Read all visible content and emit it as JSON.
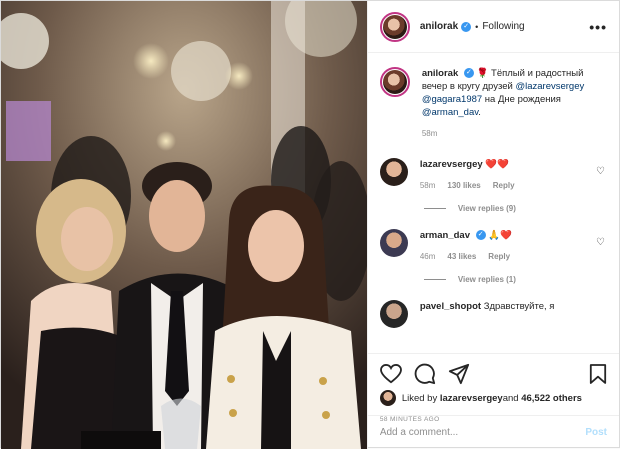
{
  "header": {
    "username": "anilorak",
    "verified_icon": "verified-badge-icon",
    "separator": "•",
    "follow_status": "Following",
    "more_label": "•••"
  },
  "caption": {
    "username": "anilorak",
    "rose": "🌹",
    "text_before": " Тёплый и радостный вечер в кругу друзей ",
    "mention1": "@lazarevsergey",
    "mention2": "@gagara1987",
    "text_mid": " на Дне рождения ",
    "mention3": "@arman_dav",
    "text_end": ".",
    "time": "58m"
  },
  "comments": [
    {
      "username": "lazarevsergey",
      "text": "❤️❤️",
      "time": "58m",
      "likes": "130 likes",
      "reply": "Reply",
      "view_replies": "View replies (9)"
    },
    {
      "username": "arman_dav",
      "text": "🙏❤️",
      "time": "46m",
      "likes": "43 likes",
      "reply": "Reply",
      "view_replies": "View replies (1)"
    },
    {
      "username": "pavel_shopot",
      "text": "Здравствуйте, я"
    }
  ],
  "likes_line": {
    "prefix": "Liked by ",
    "user": "lazarevsergey",
    "middle": " and ",
    "others": "46,522 others"
  },
  "posted_ago": "58 MINUTES AGO",
  "add_comment": {
    "placeholder": "Add a comment...",
    "post_label": "Post"
  },
  "colors": {
    "accent_blue": "#3897f0",
    "link": "#00376b",
    "like_red": "#ed4956",
    "muted": "#8e8e8e",
    "post_disabled": "#b2dffc"
  }
}
